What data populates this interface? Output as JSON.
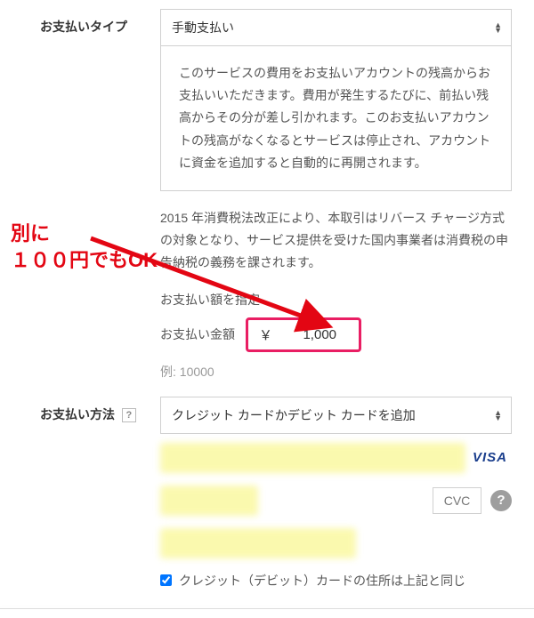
{
  "paymentType": {
    "label": "お支払いタイプ",
    "selected": "手動支払い",
    "description": "このサービスの費用をお支払いアカウントの残高からお支払いいただきます。費用が発生するたびに、前払い残高からその分が差し引かれます。このお支払いアカウントの残高がなくなるとサービスは停止され、アカウントに資金を追加すると自動的に再開されます。"
  },
  "taxNotice": "2015 年消費税法改正により、本取引はリバース チャージ方式の対象となり、サービス提供を受けた国内事業者は消費税の申告納税の義務を課されます。",
  "amount": {
    "sectionTitle": "お支払い額を指定",
    "label": "お支払い金額",
    "currency": "￥",
    "value": "1,000",
    "exampleLabel": "例: 10000"
  },
  "paymentMethod": {
    "label": "お支払い方法",
    "help": "?",
    "selected": "クレジット カードかデビット カードを追加",
    "visa": "VISA",
    "cvcPlaceholder": "CVC",
    "helpCircle": "?",
    "checkboxLabel": "クレジット（デビット）カードの住所は上記と同じ"
  },
  "annotation": {
    "line1": "別に",
    "line2": "１００円でもOK"
  }
}
